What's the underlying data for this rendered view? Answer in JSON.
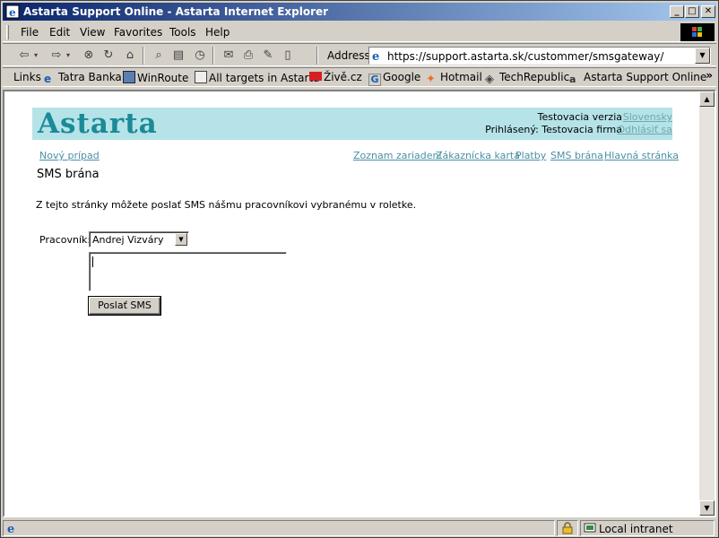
{
  "window": {
    "title": "Astarta Support Online - Astarta Internet Explorer",
    "minimize": "_",
    "maximize": "□",
    "close": "✕"
  },
  "menu": {
    "items": [
      "File",
      "Edit",
      "View",
      "Favorites",
      "Tools",
      "Help"
    ]
  },
  "address": {
    "label": "Address",
    "url": "https://support.astarta.sk/custommer/smsgateway/"
  },
  "links": {
    "label": "Links",
    "items": [
      "Tatra Banka",
      "WinRoute",
      "All targets in Astarta",
      "Živě.cz",
      "Google",
      "Hotmail",
      "TechRepublic",
      "Astarta Support Online"
    ],
    "more": "»"
  },
  "page": {
    "logo": "Astarta",
    "version": "Testovacia verzia",
    "language": "Slovensky",
    "logged_in": "Prihlásený: Testovacia firma",
    "logout": "Odhlásiť sa",
    "new_case": "Nový prípad",
    "nav": [
      "Zoznam zariadení",
      "Zákaznícka karta",
      "Platby",
      "SMS brána",
      "Hlavná stránka"
    ],
    "heading": "SMS brána",
    "intro": "Z tejto stránky môžete poslať SMS nášmu pracovníkovi vybranému v roletke.",
    "worker_label": "Pracovník:",
    "worker_selected": "Andrej Vizváry",
    "message": "",
    "send_label": "Poslať SMS"
  },
  "status": {
    "zone": "Local intranet"
  },
  "colors": {
    "banner": "#b5e3e8",
    "logo": "#1b8a96",
    "link": "#4a8fa6"
  }
}
